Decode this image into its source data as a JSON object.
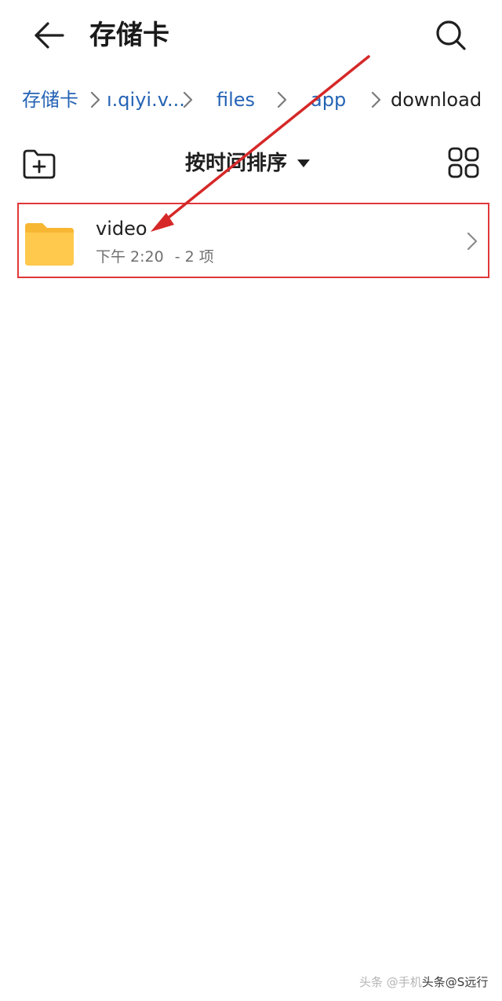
{
  "appbar": {
    "back_icon": "arrow-left-icon",
    "title": "存储卡",
    "search_icon": "search-icon"
  },
  "breadcrumb": {
    "items": [
      {
        "label": "存储卡",
        "current": false
      },
      {
        "label": "ı.qiyi.v...",
        "current": false
      },
      {
        "label": "files",
        "current": false
      },
      {
        "label": "app",
        "current": false
      },
      {
        "label": "download",
        "current": true
      }
    ],
    "separator_icon": "chevron-right-icon",
    "link_color": "#2563b5"
  },
  "toolbar": {
    "new_folder_icon": "folder-add-icon",
    "sort_label": "按时间排序",
    "sort_icon": "caret-down-icon",
    "view_icon": "grid-view-icon"
  },
  "files": [
    {
      "name": "video",
      "time": "下午 2:20",
      "separator": "-",
      "count": "2 项",
      "icon": "folder-icon",
      "folder_color": "#ffc94d"
    }
  ],
  "annotation": {
    "color": "#d62828",
    "highlight_color": "#e0383a"
  },
  "watermark": {
    "prefix": "头条 @手机",
    "sep": "头条",
    "suffix": "@S远行"
  }
}
